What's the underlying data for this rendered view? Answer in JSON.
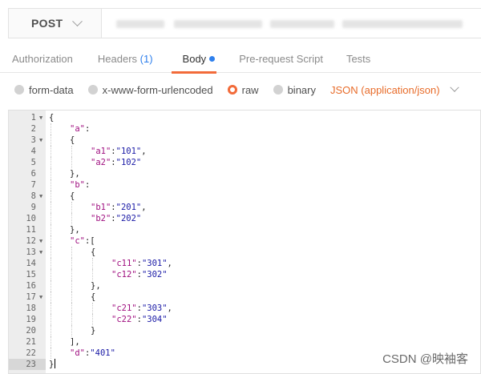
{
  "request": {
    "method": "POST"
  },
  "tabs": [
    {
      "label": "Authorization",
      "count": null,
      "active": false
    },
    {
      "label": "Headers",
      "count": "(1)",
      "active": false
    },
    {
      "label": "Body",
      "count": null,
      "active": true
    },
    {
      "label": "Pre-request Script",
      "count": null,
      "active": false
    },
    {
      "label": "Tests",
      "count": null,
      "active": false
    }
  ],
  "body_types": [
    {
      "label": "form-data",
      "selected": false
    },
    {
      "label": "x-www-form-urlencoded",
      "selected": false
    },
    {
      "label": "raw",
      "selected": true
    },
    {
      "label": "binary",
      "selected": false
    }
  ],
  "content_type": "JSON (application/json)",
  "editor": {
    "active_line": 23,
    "lines": [
      {
        "n": "1",
        "fold": true,
        "indent": 0,
        "tokens": [
          [
            "p",
            "{"
          ]
        ]
      },
      {
        "n": "2",
        "fold": false,
        "indent": 1,
        "tokens": [
          [
            "k",
            "\"a\""
          ],
          [
            "p",
            ":"
          ]
        ]
      },
      {
        "n": "3",
        "fold": true,
        "indent": 1,
        "tokens": [
          [
            "p",
            "{"
          ]
        ]
      },
      {
        "n": "4",
        "fold": false,
        "indent": 2,
        "tokens": [
          [
            "k",
            "\"a1\""
          ],
          [
            "p",
            ":"
          ],
          [
            "s",
            "\"101\""
          ],
          [
            "p",
            ","
          ]
        ]
      },
      {
        "n": "5",
        "fold": false,
        "indent": 2,
        "tokens": [
          [
            "k",
            "\"a2\""
          ],
          [
            "p",
            ":"
          ],
          [
            "s",
            "\"102\""
          ]
        ]
      },
      {
        "n": "6",
        "fold": false,
        "indent": 1,
        "tokens": [
          [
            "p",
            "},"
          ]
        ]
      },
      {
        "n": "7",
        "fold": false,
        "indent": 1,
        "tokens": [
          [
            "k",
            "\"b\""
          ],
          [
            "p",
            ":"
          ]
        ]
      },
      {
        "n": "8",
        "fold": true,
        "indent": 1,
        "tokens": [
          [
            "p",
            "{"
          ]
        ]
      },
      {
        "n": "9",
        "fold": false,
        "indent": 2,
        "tokens": [
          [
            "k",
            "\"b1\""
          ],
          [
            "p",
            ":"
          ],
          [
            "s",
            "\"201\""
          ],
          [
            "p",
            ","
          ]
        ]
      },
      {
        "n": "10",
        "fold": false,
        "indent": 2,
        "tokens": [
          [
            "k",
            "\"b2\""
          ],
          [
            "p",
            ":"
          ],
          [
            "s",
            "\"202\""
          ]
        ]
      },
      {
        "n": "11",
        "fold": false,
        "indent": 1,
        "tokens": [
          [
            "p",
            "},"
          ]
        ]
      },
      {
        "n": "12",
        "fold": true,
        "indent": 1,
        "tokens": [
          [
            "k",
            "\"c\""
          ],
          [
            "p",
            ":["
          ]
        ]
      },
      {
        "n": "13",
        "fold": true,
        "indent": 2,
        "tokens": [
          [
            "p",
            "{"
          ]
        ]
      },
      {
        "n": "14",
        "fold": false,
        "indent": 3,
        "tokens": [
          [
            "k",
            "\"c11\""
          ],
          [
            "p",
            ":"
          ],
          [
            "s",
            "\"301\""
          ],
          [
            "p",
            ","
          ]
        ]
      },
      {
        "n": "15",
        "fold": false,
        "indent": 3,
        "tokens": [
          [
            "k",
            "\"c12\""
          ],
          [
            "p",
            ":"
          ],
          [
            "s",
            "\"302\""
          ]
        ]
      },
      {
        "n": "16",
        "fold": false,
        "indent": 2,
        "tokens": [
          [
            "p",
            "},"
          ]
        ]
      },
      {
        "n": "17",
        "fold": true,
        "indent": 2,
        "tokens": [
          [
            "p",
            "{"
          ]
        ]
      },
      {
        "n": "18",
        "fold": false,
        "indent": 3,
        "tokens": [
          [
            "k",
            "\"c21\""
          ],
          [
            "p",
            ":"
          ],
          [
            "s",
            "\"303\""
          ],
          [
            "p",
            ","
          ]
        ]
      },
      {
        "n": "19",
        "fold": false,
        "indent": 3,
        "tokens": [
          [
            "k",
            "\"c22\""
          ],
          [
            "p",
            ":"
          ],
          [
            "s",
            "\"304\""
          ]
        ]
      },
      {
        "n": "20",
        "fold": false,
        "indent": 2,
        "tokens": [
          [
            "p",
            "}"
          ]
        ]
      },
      {
        "n": "21",
        "fold": false,
        "indent": 1,
        "tokens": [
          [
            "p",
            "],"
          ]
        ]
      },
      {
        "n": "22",
        "fold": false,
        "indent": 1,
        "tokens": [
          [
            "k",
            "\"d\""
          ],
          [
            "p",
            ":"
          ],
          [
            "s",
            "\"401\""
          ]
        ]
      },
      {
        "n": "23",
        "fold": false,
        "indent": 0,
        "tokens": [
          [
            "p",
            "}"
          ]
        ]
      }
    ]
  },
  "watermark": "CSDN @映袖客"
}
